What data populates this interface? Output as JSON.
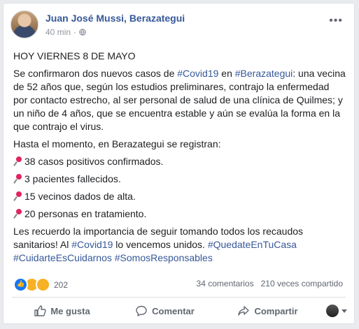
{
  "author": {
    "name": "Juan José Mussi, Berazategui",
    "time": "40 min",
    "separator": "·"
  },
  "post": {
    "line1": "HOY VIERNES 8 DE MAYO",
    "p2_a": "Se confirmaron dos nuevos casos de ",
    "tag_covid": "#Covid19",
    "p2_b": " en ",
    "tag_bera": "#Berazategui",
    "p2_c": ": una vecina de 52 años que, según los estudios preliminares, contrajo la enfermedad por contacto estrecho, al ser personal de salud de una clínica de Quilmes; y un niño de 4 años, que se encuentra estable y aún se evalúa la forma en la que contrajo el virus.",
    "p3": "Hasta el momento, en Berazategui se registran:",
    "items": [
      "38 casos positivos confirmados.",
      "3 pacientes fallecidos.",
      "15 vecinos dados de alta.",
      "20 personas en tratamiento."
    ],
    "p4_a": "Les recuerdo la importancia de seguir tomando todos los recaudos sanitarios! Al ",
    "tag_covid2": "#Covid19",
    "p4_b": " lo vencemos unidos. ",
    "tag_quedate": "#QuedateEnTuCasa",
    "tag_cuidarte": "#CuidarteEsCuidarnos",
    "tag_somos": "#SomosResponsables"
  },
  "stats": {
    "reactions": "202",
    "comments": "34 comentarios",
    "shares": "210 veces compartido"
  },
  "actions": {
    "like": "Me gusta",
    "comment": "Comentar",
    "share": "Compartir"
  },
  "colors": {
    "link": "#365899",
    "action_text": "#606770"
  }
}
